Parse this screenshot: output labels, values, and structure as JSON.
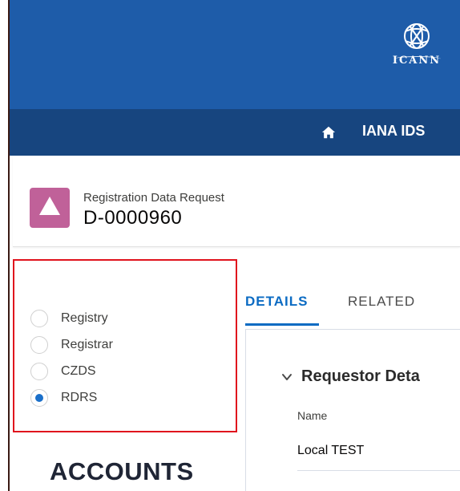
{
  "header": {
    "logo_text": "ICANN",
    "nav_label": "IANA IDS",
    "colors": {
      "header": "#1e5ca9",
      "nav": "#17457f",
      "accent": "#0b6bc3",
      "record_icon": "#c06199",
      "highlight_border": "#e0131d"
    }
  },
  "record": {
    "type": "Registration Data Request",
    "id": "D-0000960",
    "icon": "triangle-icon"
  },
  "options": {
    "items": [
      {
        "label": "Registry",
        "checked": false
      },
      {
        "label": "Registrar",
        "checked": false
      },
      {
        "label": "CZDS",
        "checked": false
      },
      {
        "label": "RDRS",
        "checked": true
      }
    ],
    "selected": "RDRS"
  },
  "tabs": {
    "details": "DETAILS",
    "related": "RELATED",
    "active": "DETAILS"
  },
  "detail": {
    "section_title": "Requestor Deta",
    "field_label": "Name",
    "field_value": "Local TEST"
  },
  "accounts": {
    "heading": "ACCOUNTS"
  },
  "icons": {
    "logo": "icann-globe-icon",
    "home": "home-icon",
    "chevron": "chevron-down-icon"
  }
}
